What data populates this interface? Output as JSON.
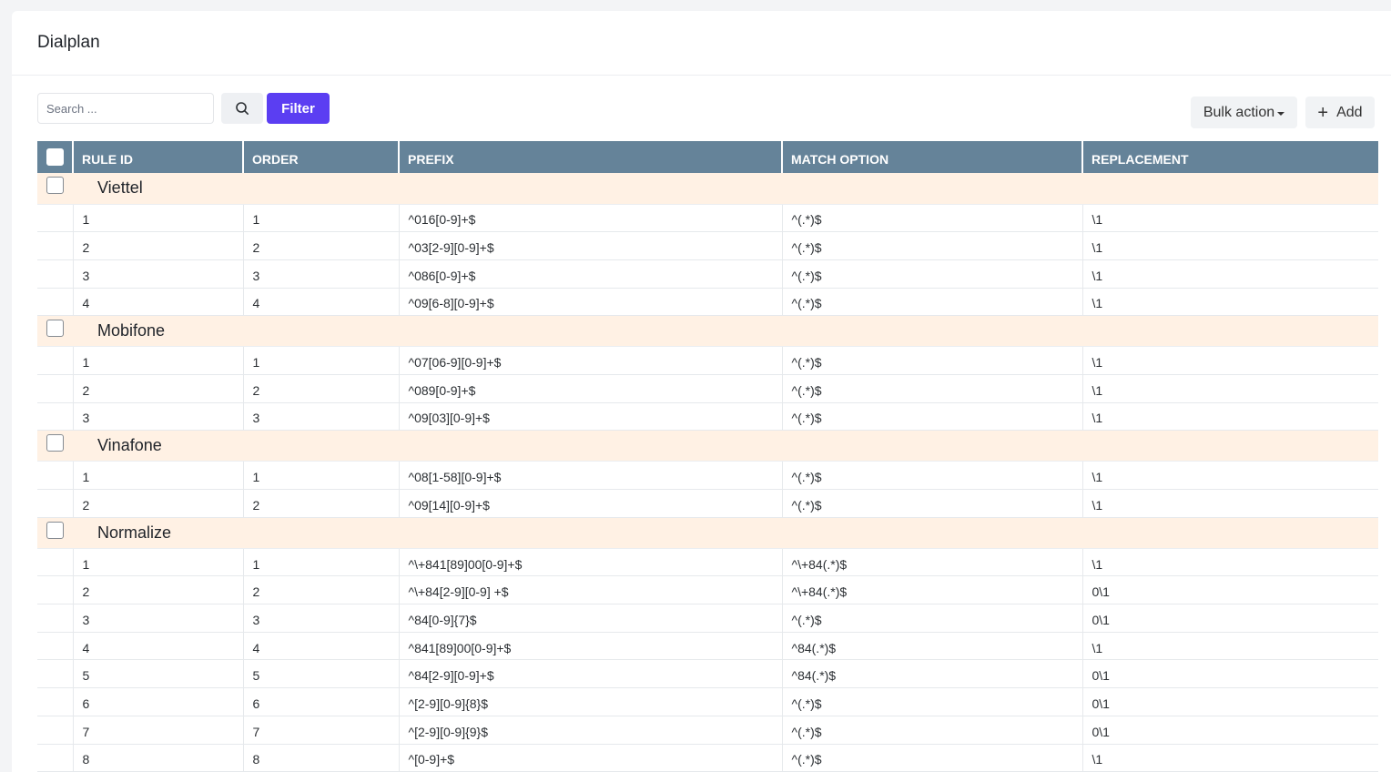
{
  "page": {
    "title": "Dialplan"
  },
  "toolbar": {
    "search_placeholder": "Search ...",
    "search_value": "",
    "filter_label": "Filter",
    "bulk_action_label": "Bulk action",
    "add_label": "Add"
  },
  "colors": {
    "accent": "#5b3ef2",
    "table_header": "#658399",
    "group_row": "#fff1e4"
  },
  "table": {
    "columns": [
      "RULE ID",
      "ORDER",
      "PREFIX",
      "MATCH OPTION",
      "REPLACEMENT"
    ],
    "groups": [
      {
        "name": "Viettel",
        "rows": [
          [
            "1",
            "1",
            "^016[0-9]+$",
            "^(.*)$",
            "\\1"
          ],
          [
            "2",
            "2",
            "^03[2-9][0-9]+$",
            "^(.*)$",
            "\\1"
          ],
          [
            "3",
            "3",
            "^086[0-9]+$",
            "^(.*)$",
            "\\1"
          ],
          [
            "4",
            "4",
            "^09[6-8][0-9]+$",
            "^(.*)$",
            "\\1"
          ]
        ]
      },
      {
        "name": "Mobifone",
        "rows": [
          [
            "1",
            "1",
            "^07[06-9][0-9]+$",
            "^(.*)$",
            "\\1"
          ],
          [
            "2",
            "2",
            "^089[0-9]+$",
            "^(.*)$",
            "\\1"
          ],
          [
            "3",
            "3",
            "^09[03][0-9]+$",
            "^(.*)$",
            "\\1"
          ]
        ]
      },
      {
        "name": "Vinafone",
        "rows": [
          [
            "1",
            "1",
            "^08[1-58][0-9]+$",
            "^(.*)$",
            "\\1"
          ],
          [
            "2",
            "2",
            "^09[14][0-9]+$",
            "^(.*)$",
            "\\1"
          ]
        ]
      },
      {
        "name": "Normalize",
        "rows": [
          [
            "1",
            "1",
            "^\\+841[89]00[0-9]+$",
            "^\\+84(.*)$",
            "\\1"
          ],
          [
            "2",
            "2",
            "^\\+84[2-9][0-9] +$",
            "^\\+84(.*)$",
            "0\\1"
          ],
          [
            "3",
            "3",
            "^84[0-9]{7}$",
            "^(.*)$",
            "0\\1"
          ],
          [
            "4",
            "4",
            "^841[89]00[0-9]+$",
            "^84(.*)$",
            "\\1"
          ],
          [
            "5",
            "5",
            "^84[2-9][0-9]+$",
            "^84(.*)$",
            "0\\1"
          ],
          [
            "6",
            "6",
            "^[2-9][0-9]{8}$",
            "^(.*)$",
            "0\\1"
          ],
          [
            "7",
            "7",
            "^[2-9][0-9]{9}$",
            "^(.*)$",
            "0\\1"
          ],
          [
            "8",
            "8",
            "^[0-9]+$",
            "^(.*)$",
            "\\1"
          ]
        ]
      }
    ]
  }
}
